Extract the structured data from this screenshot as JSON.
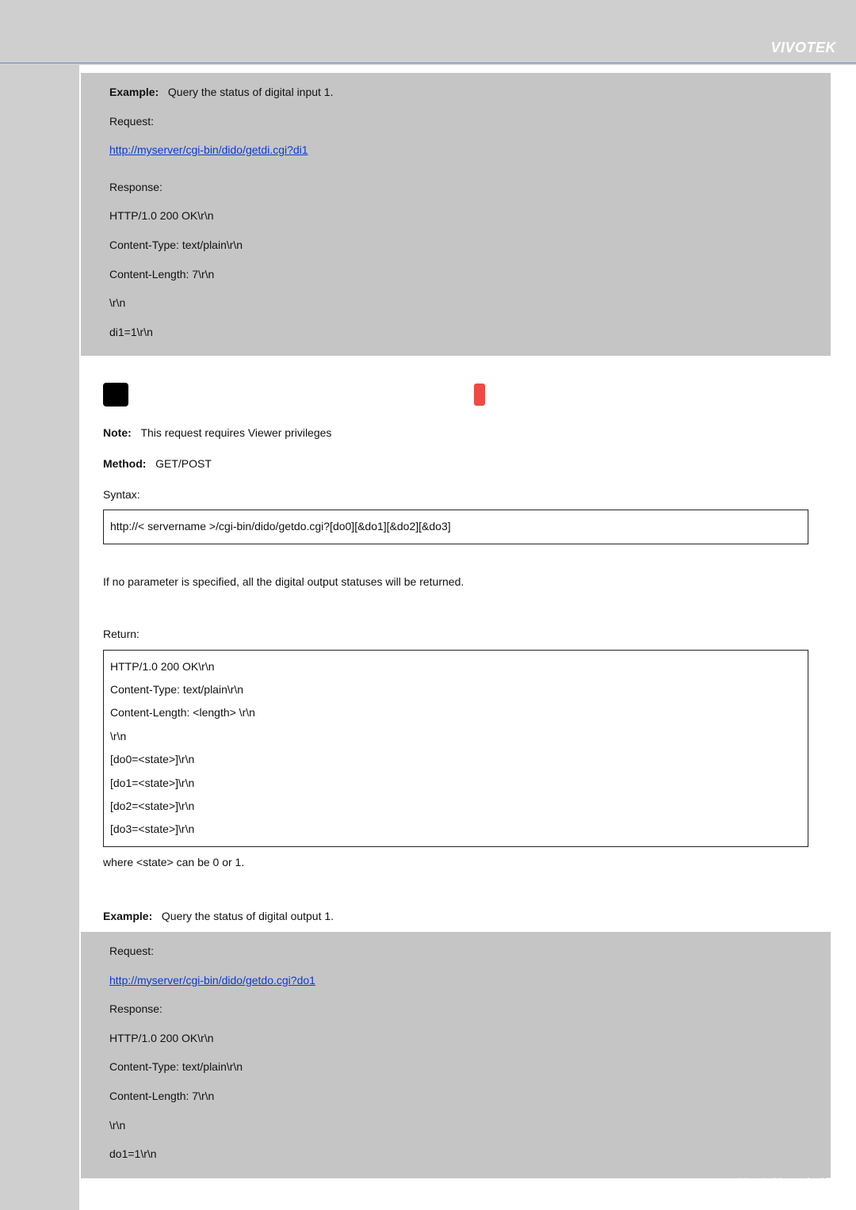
{
  "brand": "VIVOTEK",
  "example1": {
    "label": "Example:",
    "desc": "Query the status of digital input 1.",
    "request_label": "Request:",
    "request_url": "http://myserver/cgi-bin/dido/getdi.cgi?di1",
    "response_label": "Response:",
    "lines": [
      "HTTP/1.0 200 OK\\r\\n",
      "Content-Type: text/plain\\r\\n",
      "Content-Length: 7\\r\\n",
      "\\r\\n",
      "di1=1\\r\\n"
    ]
  },
  "section": {
    "note_label": "Note:",
    "note_text": "This request requires Viewer privileges",
    "method_label": "Method:",
    "method_text": "GET/POST",
    "syntax_label": "Syntax:",
    "syntax_line": "http://<  servername  >/cgi-bin/dido/getdo.cgi?[do0][&do1][&do2][&do3]",
    "noparam": "If no parameter is specified, all the digital output statuses will be returned.",
    "return_label": "Return:",
    "return_lines": [
      "HTTP/1.0 200 OK\\r\\n",
      "Content-Type: text/plain\\r\\n",
      "Content-Length:  <length>  \\r\\n",
      "\\r\\n",
      "[do0=<state>]\\r\\n",
      "[do1=<state>]\\r\\n",
      "[do2=<state>]\\r\\n",
      "[do3=<state>]\\r\\n"
    ],
    "where": "where  <state>  can be 0 or 1."
  },
  "example2": {
    "label": "Example:",
    "desc": "Query the status of digital output 1.",
    "request_label": "Request:",
    "request_url": "http://myserver/cgi-bin/dido/getdo.cgi?do1",
    "response_label": "Response:",
    "lines": [
      "HTTP/1.0 200 OK\\r\\n",
      "Content-Type: text/plain\\r\\n",
      "Content-Length: 7\\r\\n",
      "\\r\\n",
      "do1=1\\r\\n"
    ]
  },
  "footer": "User's Manual - 157"
}
